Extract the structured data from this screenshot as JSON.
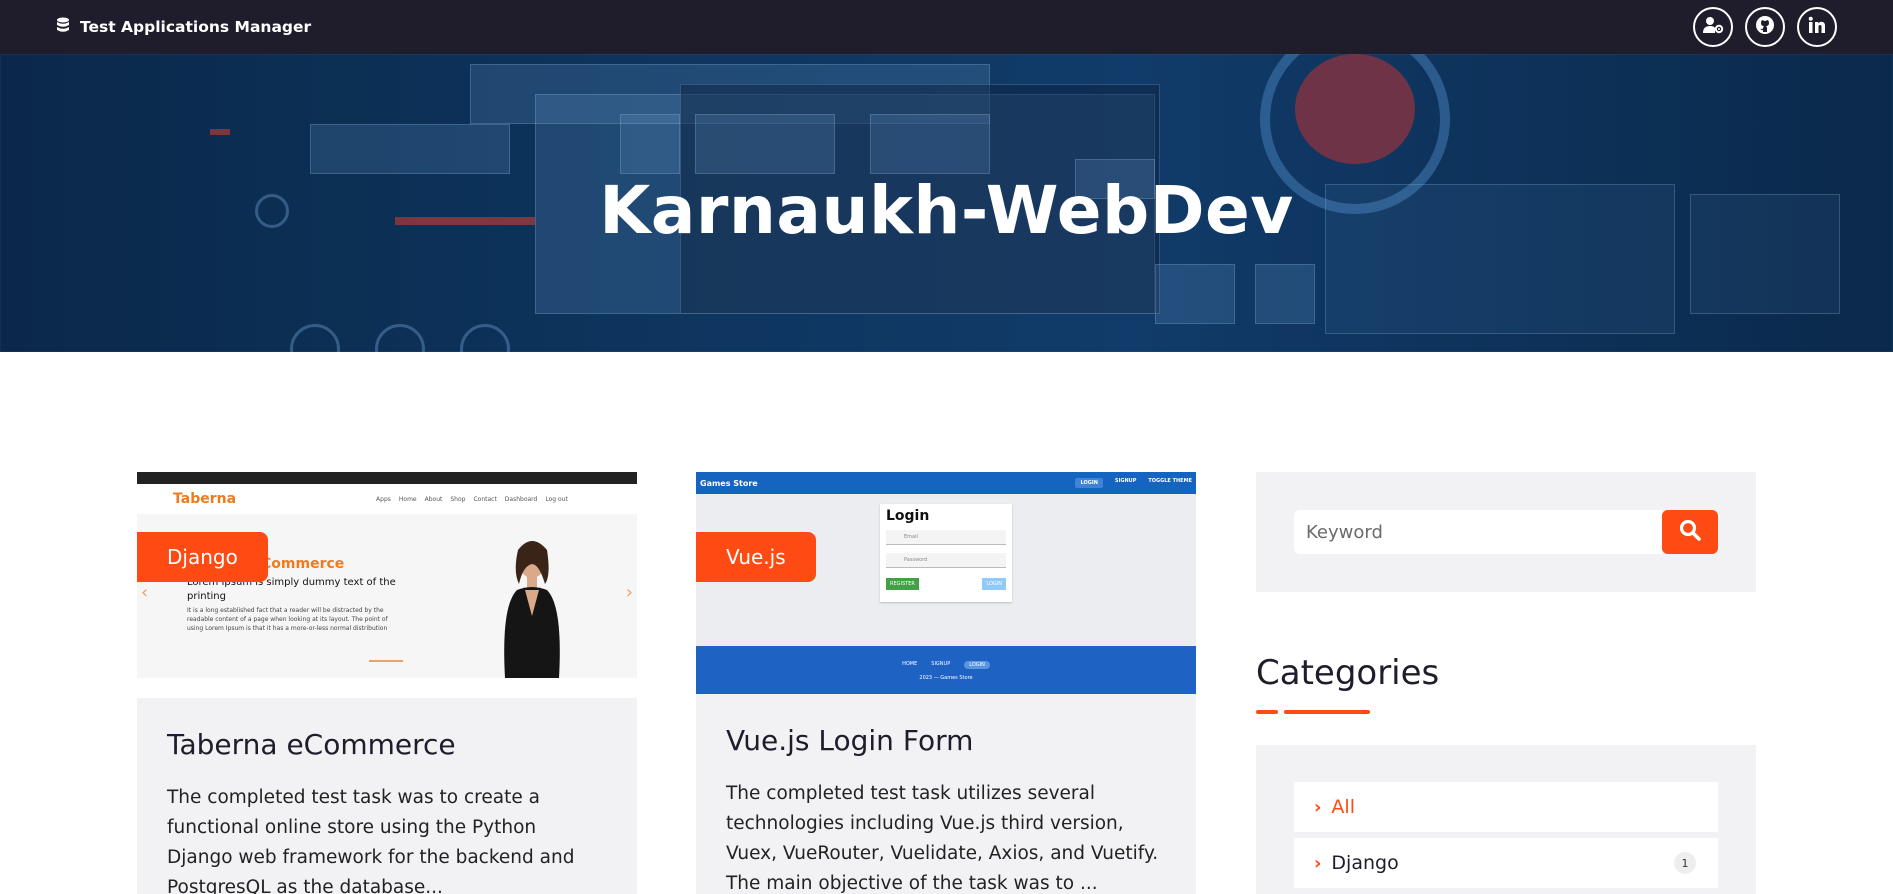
{
  "navbar": {
    "brand": "Test Applications Manager",
    "icons": [
      "user-gear-icon",
      "github-icon",
      "linkedin-icon"
    ]
  },
  "hero": {
    "title": "Karnaukh-WebDev"
  },
  "cards": [
    {
      "tag": "Django",
      "title": "Taberna eCommerce",
      "text": "The completed test task was to create a functional online store using the Python Django web framework for the backend and PostgresQL as the database...",
      "screenshot": {
        "logo": "Taberna",
        "links": [
          "Apps",
          "Home",
          "About",
          "Shop",
          "Contact",
          "Dashboard",
          "Log out"
        ],
        "heading": "Commerce",
        "subheading": "Lorem Ipsum is simply dummy text of the printing",
        "paragraph": "It is a long established fact that a reader will be distracted by the readable content of a page when looking at its layout. The point of using Lorem Ipsum is that it has a more-or-less normal distribution"
      }
    },
    {
      "tag": "Vue.js",
      "title": "Vue.js Login Form",
      "text": "The completed test task utilizes several technologies including Vue.js third version, Vuex, VueRouter, Vuelidate, Axios, and Vuetify. The main objective of the task was to ...",
      "screenshot": {
        "app_name": "Games Store",
        "nav": [
          "LOGIN",
          "SIGNUP",
          "TOGGLE THEME"
        ],
        "form_title": "Login",
        "email_placeholder": "Email",
        "password_placeholder": "Password",
        "register_label": "REGISTER",
        "login_label": "LOGIN",
        "footer_links": [
          "HOME",
          "SIGNUP",
          "LOGIN"
        ],
        "footer_text": "2023 — Games Store"
      }
    }
  ],
  "sidebar": {
    "search": {
      "placeholder": "Keyword"
    },
    "categories": {
      "title": "Categories",
      "items": [
        {
          "label": "All",
          "active": true
        },
        {
          "label": "Django",
          "count": "1"
        }
      ]
    }
  },
  "colors": {
    "accent": "#fd4b13",
    "navbar": "#1f1d2b",
    "panel": "#f2f2f4"
  }
}
